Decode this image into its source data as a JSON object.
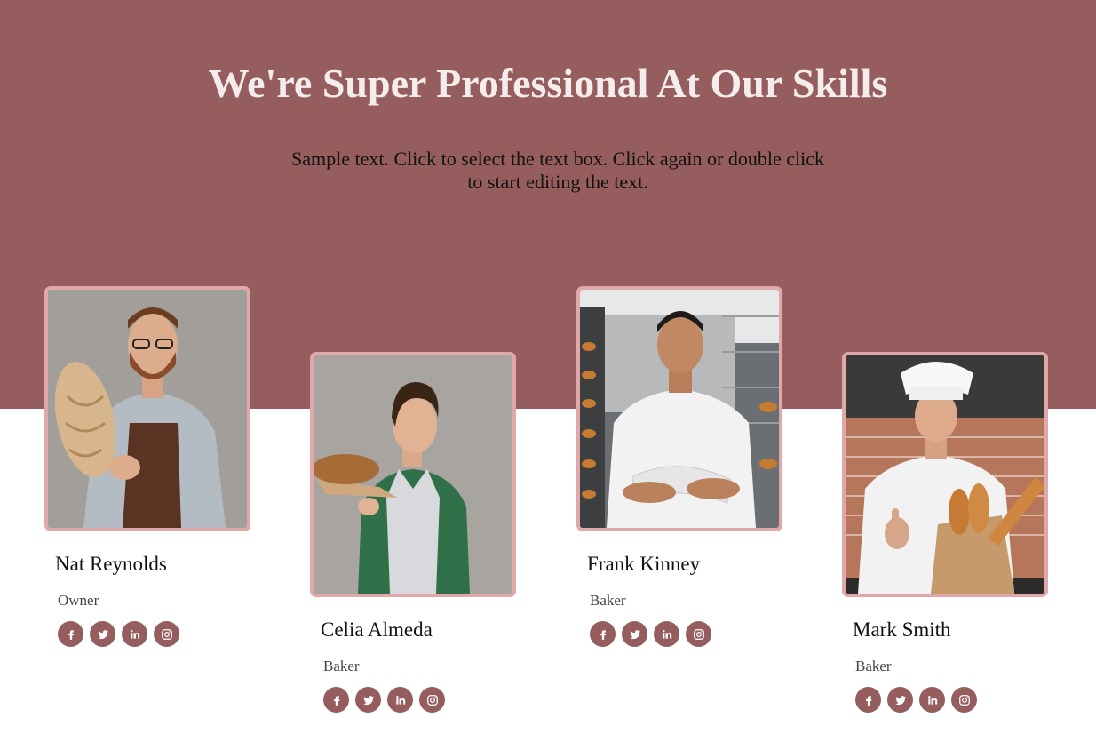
{
  "hero": {
    "title": "We're Super Professional At Our Skills",
    "subtitle": "Sample text. Click to select the text box. Click again or double click to start editing the text."
  },
  "colors": {
    "band": "#955d5d",
    "photo_border": "#e0a8a8",
    "social_bg": "#955d5d"
  },
  "team": [
    {
      "name": "Nat Reynolds",
      "role": "Owner",
      "photo": "bearded baker in apron holding bread loaf",
      "socials": [
        "facebook-icon",
        "twitter-icon",
        "linkedin-icon",
        "instagram-icon"
      ]
    },
    {
      "name": "Celia Almeda",
      "role": "Baker",
      "photo": "woman in apron holding bread on paper",
      "socials": [
        "facebook-icon",
        "twitter-icon",
        "linkedin-icon",
        "instagram-icon"
      ]
    },
    {
      "name": "Frank Kinney",
      "role": "Baker",
      "photo": "chef in white jacket with arms crossed in bakery",
      "socials": [
        "facebook-icon",
        "twitter-icon",
        "linkedin-icon",
        "instagram-icon"
      ]
    },
    {
      "name": "Mark Smith",
      "role": "Baker",
      "photo": "chef in toque holding bag of baguettes, thumbs up",
      "socials": [
        "facebook-icon",
        "twitter-icon",
        "linkedin-icon",
        "instagram-icon"
      ]
    }
  ]
}
